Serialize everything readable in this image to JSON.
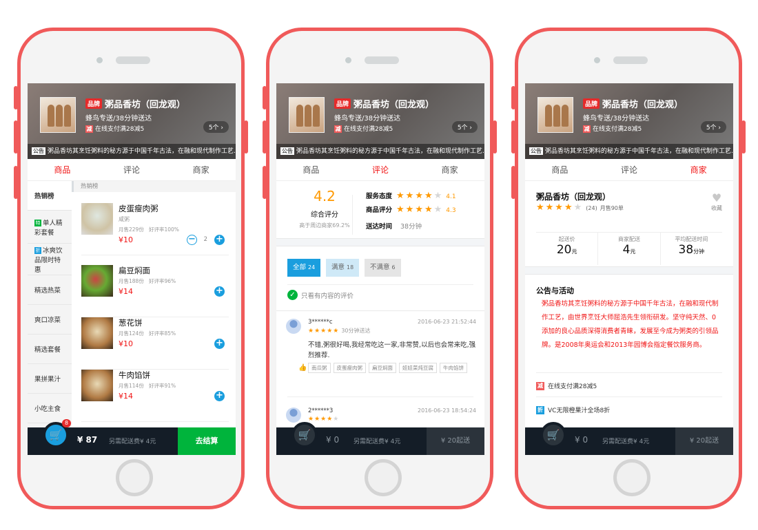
{
  "shop": {
    "brand_tag": "品牌",
    "name": "粥品香坊（回龙观）",
    "delivery": "蜂鸟专送/38分钟送达",
    "pay_badge": "减",
    "pay_promo": "在线支付满28减5",
    "more_btn": "5个 ›",
    "notice_tag": "公告",
    "notice": "粥品香坊其烹饪粥料的秘方源于中国千年古法，在融和现代制作工艺…"
  },
  "tabs": [
    "商品",
    "评论",
    "商家"
  ],
  "phone1": {
    "categories": [
      {
        "label": "热销榜"
      },
      {
        "tag": "特",
        "label": "单人精彩套餐"
      },
      {
        "tag": "折",
        "label": "冰爽饮品限时特惠"
      },
      {
        "label": "精选热菜"
      },
      {
        "label": "爽口凉菜"
      },
      {
        "label": "精选套餐"
      },
      {
        "label": "果拼果汁"
      },
      {
        "label": "小吃主食"
      }
    ],
    "section_title": "热销榜",
    "foods": [
      {
        "name": "皮蛋瘦肉粥",
        "desc": "咸粥",
        "sales": "月售229份",
        "rating": "好评率100%",
        "price": "¥10",
        "qty": "2"
      },
      {
        "name": "扁豆焖面",
        "sales": "月售188份",
        "rating": "好评率96%",
        "price": "¥14"
      },
      {
        "name": "葱花饼",
        "sales": "月售124份",
        "rating": "好评率85%",
        "price": "¥10"
      },
      {
        "name": "牛肉馅饼",
        "sales": "月售114份",
        "rating": "好评率91%",
        "price": "¥14"
      }
    ],
    "cart": {
      "count": "8",
      "total": "¥ 87",
      "fee": "另需配送费¥ 4元",
      "checkout": "去结算"
    }
  },
  "phone2": {
    "overall": {
      "score": "4.2",
      "label": "综合评分",
      "sub": "高于周边商家69.2%"
    },
    "service": {
      "label": "服务态度",
      "value": "4.1"
    },
    "food": {
      "label": "商品评分",
      "value": "4.3"
    },
    "delivery": {
      "label": "送达时间",
      "value": "38分钟"
    },
    "filters": [
      {
        "label": "全部",
        "count": "24"
      },
      {
        "label": "满意",
        "count": "18"
      },
      {
        "label": "不满意",
        "count": "6"
      }
    ],
    "only_content": "只看有内容的评价",
    "reviews": [
      {
        "user": "3******c",
        "time": "2016-06-23 21:52:44",
        "eta": "30分钟送达",
        "text": "不错,粥很好喝,我经常吃这一家,非常赞,以后也会常来吃,强烈推荐.",
        "tags": [
          "南瓜粥",
          "皮蛋瘦肉粥",
          "扁豆焖面",
          "娃娃菜炖豆腐",
          "牛肉馅饼"
        ]
      },
      {
        "user": "2******3",
        "time": "2016-06-23 18:54:24"
      }
    ],
    "cart": {
      "total": "¥ 0",
      "fee": "另需配送费¥ 4元",
      "min": "¥ 20起送"
    }
  },
  "phone3": {
    "name": "粥品香坊（回龙观）",
    "rating_count": "(24)",
    "monthly": "月售90单",
    "fav": "收藏",
    "stats": [
      {
        "label": "起送价",
        "value": "20",
        "unit": "元"
      },
      {
        "label": "商家配送",
        "value": "4",
        "unit": "元"
      },
      {
        "label": "平均配送时间",
        "value": "38",
        "unit": "分钟"
      }
    ],
    "notice_title": "公告与活动",
    "notice": "粥品香坊其烹饪粥料的秘方源于中国千年古法，在融和现代制作工艺，由世界烹饪大师屈浩先生领衔研发。坚守纯天然、0添加的良心品质深得消费者青睐，发展至今成为粥类的引领品牌。是2008年奥运会和2013年园博会指定餐饮服务商。",
    "promos": [
      {
        "tag": "减",
        "text": "在线支付满28减5"
      },
      {
        "tag": "折",
        "text": "VC无限橙果汁全场8折"
      }
    ],
    "cart": {
      "total": "¥ 0",
      "fee": "另需配送费¥ 4元",
      "min": "¥ 20起送"
    }
  },
  "colors": {
    "frame": "#f05a5a",
    "accent": "#1a9ede",
    "active_tab": "#f01414",
    "star": "#ff9900",
    "checkout": "#00b43c"
  }
}
